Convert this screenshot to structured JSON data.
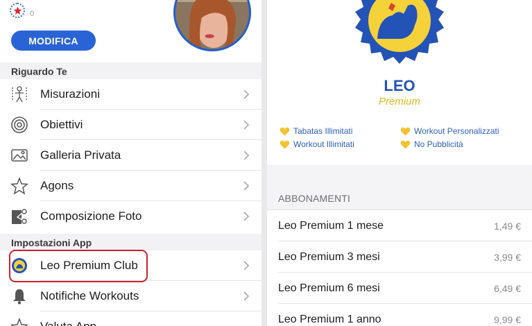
{
  "profile": {
    "star_count": "0",
    "edit_label": "MODIFICA"
  },
  "sections": {
    "about": "Riguardo Te",
    "settings": "Impostazioni App"
  },
  "menu": {
    "measurements": "Misurazioni",
    "goals": "Obiettivi",
    "gallery": "Galleria Privata",
    "agons": "Agons",
    "photo_compose": "Composizione Foto",
    "premium_club": "Leo Premium Club",
    "notifications": "Notifiche Workouts",
    "rate_app": "Valuta App"
  },
  "club": {
    "name": "LEO",
    "tier": "Premium",
    "perks": [
      "Tabatas Illimitati",
      "Workout Personalizzati",
      "Workout Illimitati",
      "No Pubblicità"
    ]
  },
  "subscriptions": {
    "header": "ABBONAMENTI",
    "items": [
      {
        "name": "Leo Premium 1 mese",
        "price": "1,49 €"
      },
      {
        "name": "Leo Premium 3 mesi",
        "price": "3,99 €"
      },
      {
        "name": "Leo Premium 6 mesi",
        "price": "6,49 €"
      },
      {
        "name": "Leo Premium 1 anno",
        "price": "9,99 €"
      }
    ]
  },
  "colors": {
    "accent_blue": "#2a63d6",
    "premium_gold": "#e0b91a",
    "highlight_red": "#cc1f2b"
  }
}
